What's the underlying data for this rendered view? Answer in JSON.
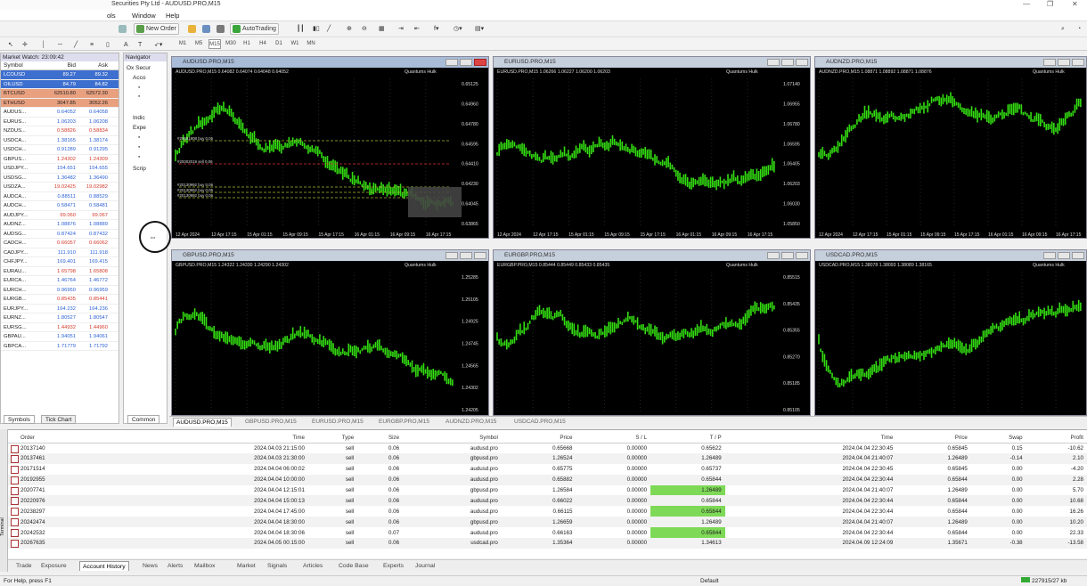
{
  "window": {
    "title": "Securities Pty Ltd - AUDUSD.PRO,M15",
    "controls": {
      "minimize": "—",
      "maximize": "❐",
      "close": "✕"
    }
  },
  "menu": [
    "ols",
    "Window",
    "Help"
  ],
  "toolbar": {
    "new_order": "New Order",
    "auto_trading": "AutoTrading",
    "timeframes": [
      "M1",
      "M5",
      "M15",
      "M30",
      "H1",
      "H4",
      "D1",
      "W1",
      "MN"
    ]
  },
  "market_watch": {
    "title": "Market Watch: 23:09:42",
    "headers": {
      "symbol": "Symbol",
      "bid": "Bid",
      "ask": "Ask"
    },
    "rows": [
      {
        "symbol": "LCOUSD",
        "bid": "89.27",
        "ask": "89.32"
      },
      {
        "symbol": "OILUSD",
        "bid": "84.79",
        "ask": "84.82"
      },
      {
        "symbol": "BTCUSD",
        "bid": "62510.80",
        "ask": "62572.30"
      },
      {
        "symbol": "ETHUSD",
        "bid": "3047.85",
        "ask": "3052.26"
      },
      {
        "symbol": "AUDUS...",
        "bid": "0.64052",
        "ask": "0.64058"
      },
      {
        "symbol": "EURUS...",
        "bid": "1.06203",
        "ask": "1.06208"
      },
      {
        "symbol": "NZDUS...",
        "bid": "0.58826",
        "ask": "0.58834"
      },
      {
        "symbol": "USDCA...",
        "bid": "1.38165",
        "ask": "1.38174"
      },
      {
        "symbol": "USDCH...",
        "bid": "0.91289",
        "ask": "0.91295"
      },
      {
        "symbol": "GBPUS...",
        "bid": "1.24302",
        "ask": "1.24309"
      },
      {
        "symbol": "USDJPY...",
        "bid": "154.651",
        "ask": "154.655"
      },
      {
        "symbol": "USDSG...",
        "bid": "1.36482",
        "ask": "1.36490"
      },
      {
        "symbol": "USDZA...",
        "bid": "19.02425",
        "ask": "19.02982"
      },
      {
        "symbol": "AUDCA...",
        "bid": "0.88511",
        "ask": "0.88529"
      },
      {
        "symbol": "AUDCH...",
        "bid": "0.58471",
        "ask": "0.58481"
      },
      {
        "symbol": "AUDJPY...",
        "bid": "99.060",
        "ask": "99.067"
      },
      {
        "symbol": "AUDNZ...",
        "bid": "1.08876",
        "ask": "1.08889"
      },
      {
        "symbol": "AUDSG...",
        "bid": "0.87424",
        "ask": "0.87432"
      },
      {
        "symbol": "CADCH...",
        "bid": "0.66057",
        "ask": "0.66062"
      },
      {
        "symbol": "CADJPY...",
        "bid": "111.910",
        "ask": "111.918"
      },
      {
        "symbol": "CHFJPY...",
        "bid": "169.401",
        "ask": "169.415"
      },
      {
        "symbol": "EURAU...",
        "bid": "1.65798",
        "ask": "1.65808"
      },
      {
        "symbol": "EURCA...",
        "bid": "1.46764",
        "ask": "1.46772"
      },
      {
        "symbol": "EURCH...",
        "bid": "0.96950",
        "ask": "0.96959"
      },
      {
        "symbol": "EURGB...",
        "bid": "0.85435",
        "ask": "0.85441"
      },
      {
        "symbol": "EURJPY...",
        "bid": "164.232",
        "ask": "164.236"
      },
      {
        "symbol": "EURNZ...",
        "bid": "1.80527",
        "ask": "1.80547"
      },
      {
        "symbol": "EURSG...",
        "bid": "1.44932",
        "ask": "1.44960"
      },
      {
        "symbol": "GBPAU...",
        "bid": "1.94051",
        "ask": "1.94061"
      },
      {
        "symbol": "GBPCA...",
        "bid": "1.71779",
        "ask": "1.71792"
      }
    ],
    "tabs": [
      "Symbols",
      "Tick Chart"
    ]
  },
  "navigator": {
    "title": "Navigator",
    "items": [
      "Ox Secur",
      "Acco",
      "Indic",
      "Expe",
      "Scrip"
    ],
    "tab": "Common"
  },
  "charts": [
    {
      "title": "AUDUSD.PRO,M15",
      "info": "AUDUSD.PRO,M15  0.64082 0.64074 0.64048 0.64052",
      "indicator": "Quantums Hulk",
      "prices": [
        "0.65125",
        "0.64960",
        "0.64780",
        "0.64595",
        "0.64410",
        "0.64230",
        "0.64045",
        "0.63865"
      ],
      "dates": [
        "12 Apr 2024",
        "12 Apr 17:15",
        "15 Apr 01:15",
        "15 Apr 09:15",
        "15 Apr 17:15",
        "16 Apr 01:15",
        "16 Apr 09:15",
        "16 Apr 17:15"
      ],
      "labels": [
        "#20001808 buy 0.05",
        "#20002019 sell 0.06",
        "#20130992 buy 0.06",
        "#20130992 buy 0.06",
        "#20130992 buy 0.06"
      ]
    },
    {
      "title": "EURUSD.PRO,M15",
      "info": "EURUSD.PRO,M15  1.06266 1.06227 1.06200 1.06203",
      "indicator": "Quantums Hulk",
      "prices": [
        "1.07140",
        "1.06955",
        "1.06780",
        "1.06595",
        "1.06405",
        "1.06203",
        "1.06030",
        "1.05850"
      ],
      "dates": [
        "12 Apr 2024",
        "12 Apr 17:15",
        "15 Apr 01:15",
        "15 Apr 09:15",
        "15 Apr 17:15",
        "16 Apr 01:15",
        "16 Apr 09:15",
        "16 Apr 17:15"
      ]
    },
    {
      "title": "AUDNZD.PRO,M15",
      "info": "AUDNZD.PRO,M15  1.08871 1.08892 1.08871 1.08876",
      "indicator": "Quantums Hulk",
      "prices": [],
      "dates": [
        "12 Apr 2024",
        "12 Apr 17:15",
        "15 Apr 01:15",
        "15 Apr 09:15",
        "15 Apr 17:15",
        "16 Apr 01:15",
        "16 Apr 09:15",
        "16 Apr 17:15"
      ]
    },
    {
      "title": "GBPUSD.PRO,M15",
      "info": "GBPUSD.PRO,M15  1.24322 1.24330 1.24290 1.24302",
      "indicator": "Quantums Hulk",
      "prices": [
        "1.25285",
        "1.25105",
        "1.24925",
        "1.24745",
        "1.24565",
        "1.24302",
        "1.24205"
      ]
    },
    {
      "title": "EURGBP.PRO,M15",
      "info": "EURGBP.PRO,M15  0.85444 0.85449 0.85433 0.85435",
      "indicator": "Quantums Hulk",
      "prices": [
        "0.85515",
        "0.85435",
        "0.85355",
        "0.85270",
        "0.85185",
        "0.85105"
      ]
    },
    {
      "title": "USDCAD.PRO,M15",
      "info": "USDCAD.PRO,M15  1.38078 1.38093 1.38089 1.38165",
      "indicator": "Quantums Hulk",
      "prices": []
    }
  ],
  "chart_tabs": [
    "AUDUSD.PRO,M15",
    "GBPUSD.PRO,M15",
    "EURUSD.PRO,M15",
    "EURGBP.PRO,M15",
    "AUDNZD.PRO,M15",
    "USDCAD.PRO,M15"
  ],
  "terminal": {
    "side_label": "Terminal",
    "headers": [
      "Order",
      "Time",
      "Type",
      "Size",
      "Symbol",
      "Price",
      "S / L",
      "T / P",
      "Time",
      "Price",
      "Swap",
      "Profit"
    ],
    "rows": [
      [
        "20137140",
        "2024.04.03 21:15:00",
        "sell",
        "0.06",
        "audusd.pro",
        "0.65668",
        "0.00000",
        "0.65622",
        "2024.04.04 22:30:45",
        "0.65845",
        "0.15",
        "-10.62"
      ],
      [
        "20137461",
        "2024.04.03 21:30:00",
        "sell",
        "0.06",
        "gbpusd.pro",
        "1.26524",
        "0.00000",
        "1.26489",
        "2024.04.04 21:40:07",
        "1.26489",
        "-0.14",
        "2.10"
      ],
      [
        "20171514",
        "2024.04.04 06:00:02",
        "sell",
        "0.06",
        "audusd.pro",
        "0.65775",
        "0.00000",
        "0.65737",
        "2024.04.04 22:30:45",
        "0.65845",
        "0.00",
        "-4.20"
      ],
      [
        "20192955",
        "2024.04.04 10:00:00",
        "sell",
        "0.06",
        "audusd.pro",
        "0.65882",
        "0.00000",
        "0.65844",
        "2024.04.04 22:30:44",
        "0.65844",
        "0.00",
        "2.28"
      ],
      [
        "20207741",
        "2024.04.04 12:15:01",
        "sell",
        "0.06",
        "gbpusd.pro",
        "1.26584",
        "0.00000",
        "1.26489",
        "2024.04.04 21:40:07",
        "1.26489",
        "0.00",
        "5.70"
      ],
      [
        "20220976",
        "2024.04.04 15:00:13",
        "sell",
        "0.06",
        "audusd.pro",
        "0.66022",
        "0.00000",
        "0.65844",
        "2024.04.04 22:30:44",
        "0.65844",
        "0.00",
        "10.68"
      ],
      [
        "20238297",
        "2024.04.04 17:45:00",
        "sell",
        "0.06",
        "audusd.pro",
        "0.66115",
        "0.00000",
        "0.65844",
        "2024.04.04 22:30:44",
        "0.65844",
        "0.00",
        "16.26"
      ],
      [
        "20242474",
        "2024.04.04 18:30:00",
        "sell",
        "0.06",
        "gbpusd.pro",
        "1.26659",
        "0.00000",
        "1.26489",
        "2024.04.04 21:40:07",
        "1.26489",
        "0.00",
        "10.20"
      ],
      [
        "20242532",
        "2024.04.04 18:30:06",
        "sell",
        "0.07",
        "audusd.pro",
        "0.66163",
        "0.00000",
        "0.65844",
        "2024.04.04 22:30:44",
        "0.65844",
        "0.00",
        "22.33"
      ],
      [
        "20267635",
        "2024.04.05 00:15:00",
        "sell",
        "0.06",
        "usdcad.pro",
        "1.35364",
        "0.00000",
        "1.34613",
        "2024.04.09 12:24:09",
        "1.35671",
        "-0.38",
        "-13.58"
      ]
    ],
    "tp_highlight": [
      false,
      true,
      false,
      true,
      true,
      true,
      true,
      true,
      true,
      true
    ],
    "tabs": [
      "Trade",
      "Exposure",
      "Account History",
      "News",
      "Alerts",
      "Mailbox",
      "Market",
      "Signals",
      "Articles",
      "Code Base",
      "Experts",
      "Journal"
    ],
    "active_tab": "Account History"
  },
  "status": {
    "help": "For Help, press F1",
    "profile": "Default",
    "traffic": "227915/27 kb"
  },
  "colors": {
    "candle": "#33dd11",
    "chart_bg": "#000000",
    "tp_cell": "#7ed957",
    "ask_up": "#2a5fd6",
    "bid_down": "#d63a2a"
  }
}
